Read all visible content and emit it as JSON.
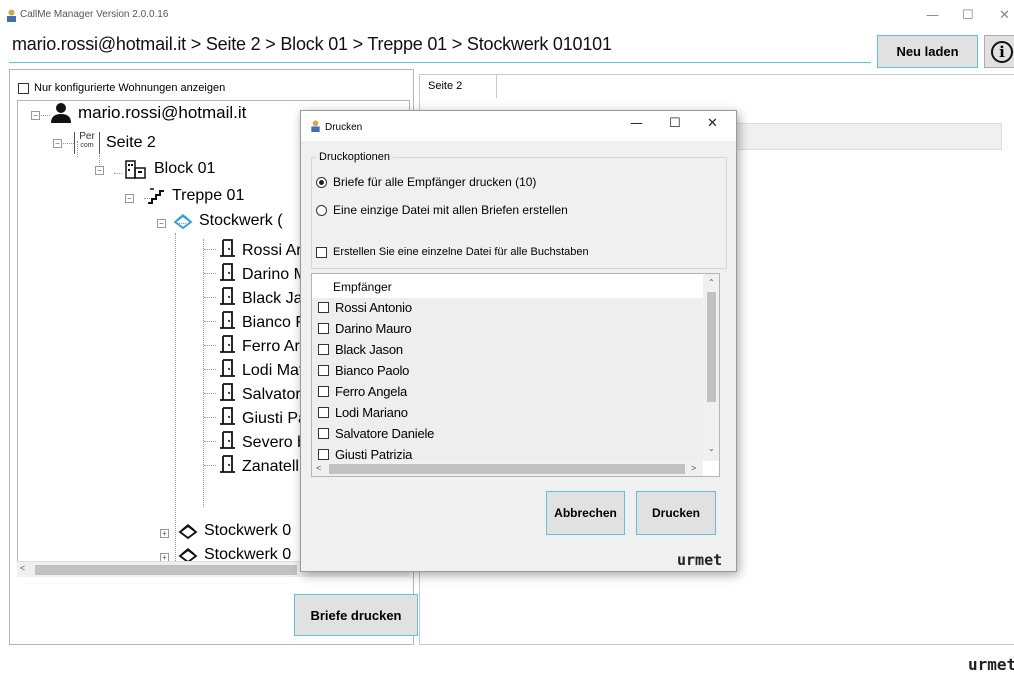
{
  "window": {
    "title": "CallMe Manager Version 2.0.0.16",
    "minimize": "—",
    "maximize": "☐",
    "close": "✕"
  },
  "breadcrumb": "mario.rossi@hotmail.it > Seite 2 > Block 01 > Treppe 01 > Stockwerk 010101",
  "toolbar": {
    "reload_label": "Neu laden",
    "info_label": "i"
  },
  "left": {
    "filter_label": "Nur konfigurierte Wohnungen anzeigen",
    "print_button": "Briefe drucken"
  },
  "tree": {
    "user": "mario.rossi@hotmail.it",
    "page": "Seite 2",
    "page_icon_text_top": "Per",
    "page_icon_text_bottom": "com",
    "block": "Block 01",
    "stairs": "Treppe 01",
    "floor_active": "Stockwerk (",
    "apartments": [
      "Rossi Ar",
      "Darino M",
      "Black Ja",
      "Bianco F",
      "Ferro Ar",
      "Lodi Mat",
      "Salvator",
      "Giusti Pa",
      "Severo b",
      "Zanatell"
    ],
    "floor2": "Stockwerk 0",
    "floor3": "Stockwerk 0"
  },
  "right": {
    "tab_label": "Seite 2"
  },
  "dialog": {
    "title": "Drucken",
    "minimize": "—",
    "maximize": "☐",
    "close": "✕",
    "group_label": "Druckoptionen",
    "option1": "Briefe für alle Empfänger drucken (10)",
    "option2": "Eine einzige Datei mit allen Briefen erstellen",
    "single_file_check": "Erstellen Sie eine einzelne Datei für alle Buchstaben",
    "list_header": "Empfänger",
    "recipients": [
      "Rossi Antonio",
      "Darino Mauro",
      "Black Jason",
      "Bianco Paolo",
      "Ferro Angela",
      "Lodi Mariano",
      "Salvatore Daniele",
      "Giusti Patrizia"
    ],
    "cancel_label": "Abbrechen",
    "print_label": "Drucken",
    "logo": "urmet"
  },
  "footer_logo": "urmet",
  "colors": {
    "accent": "#5ec3d8",
    "button_bg": "#e1e1e1",
    "dialog_bg": "#f0f0f0",
    "floor_icon_blue": "#2f9fd8"
  }
}
